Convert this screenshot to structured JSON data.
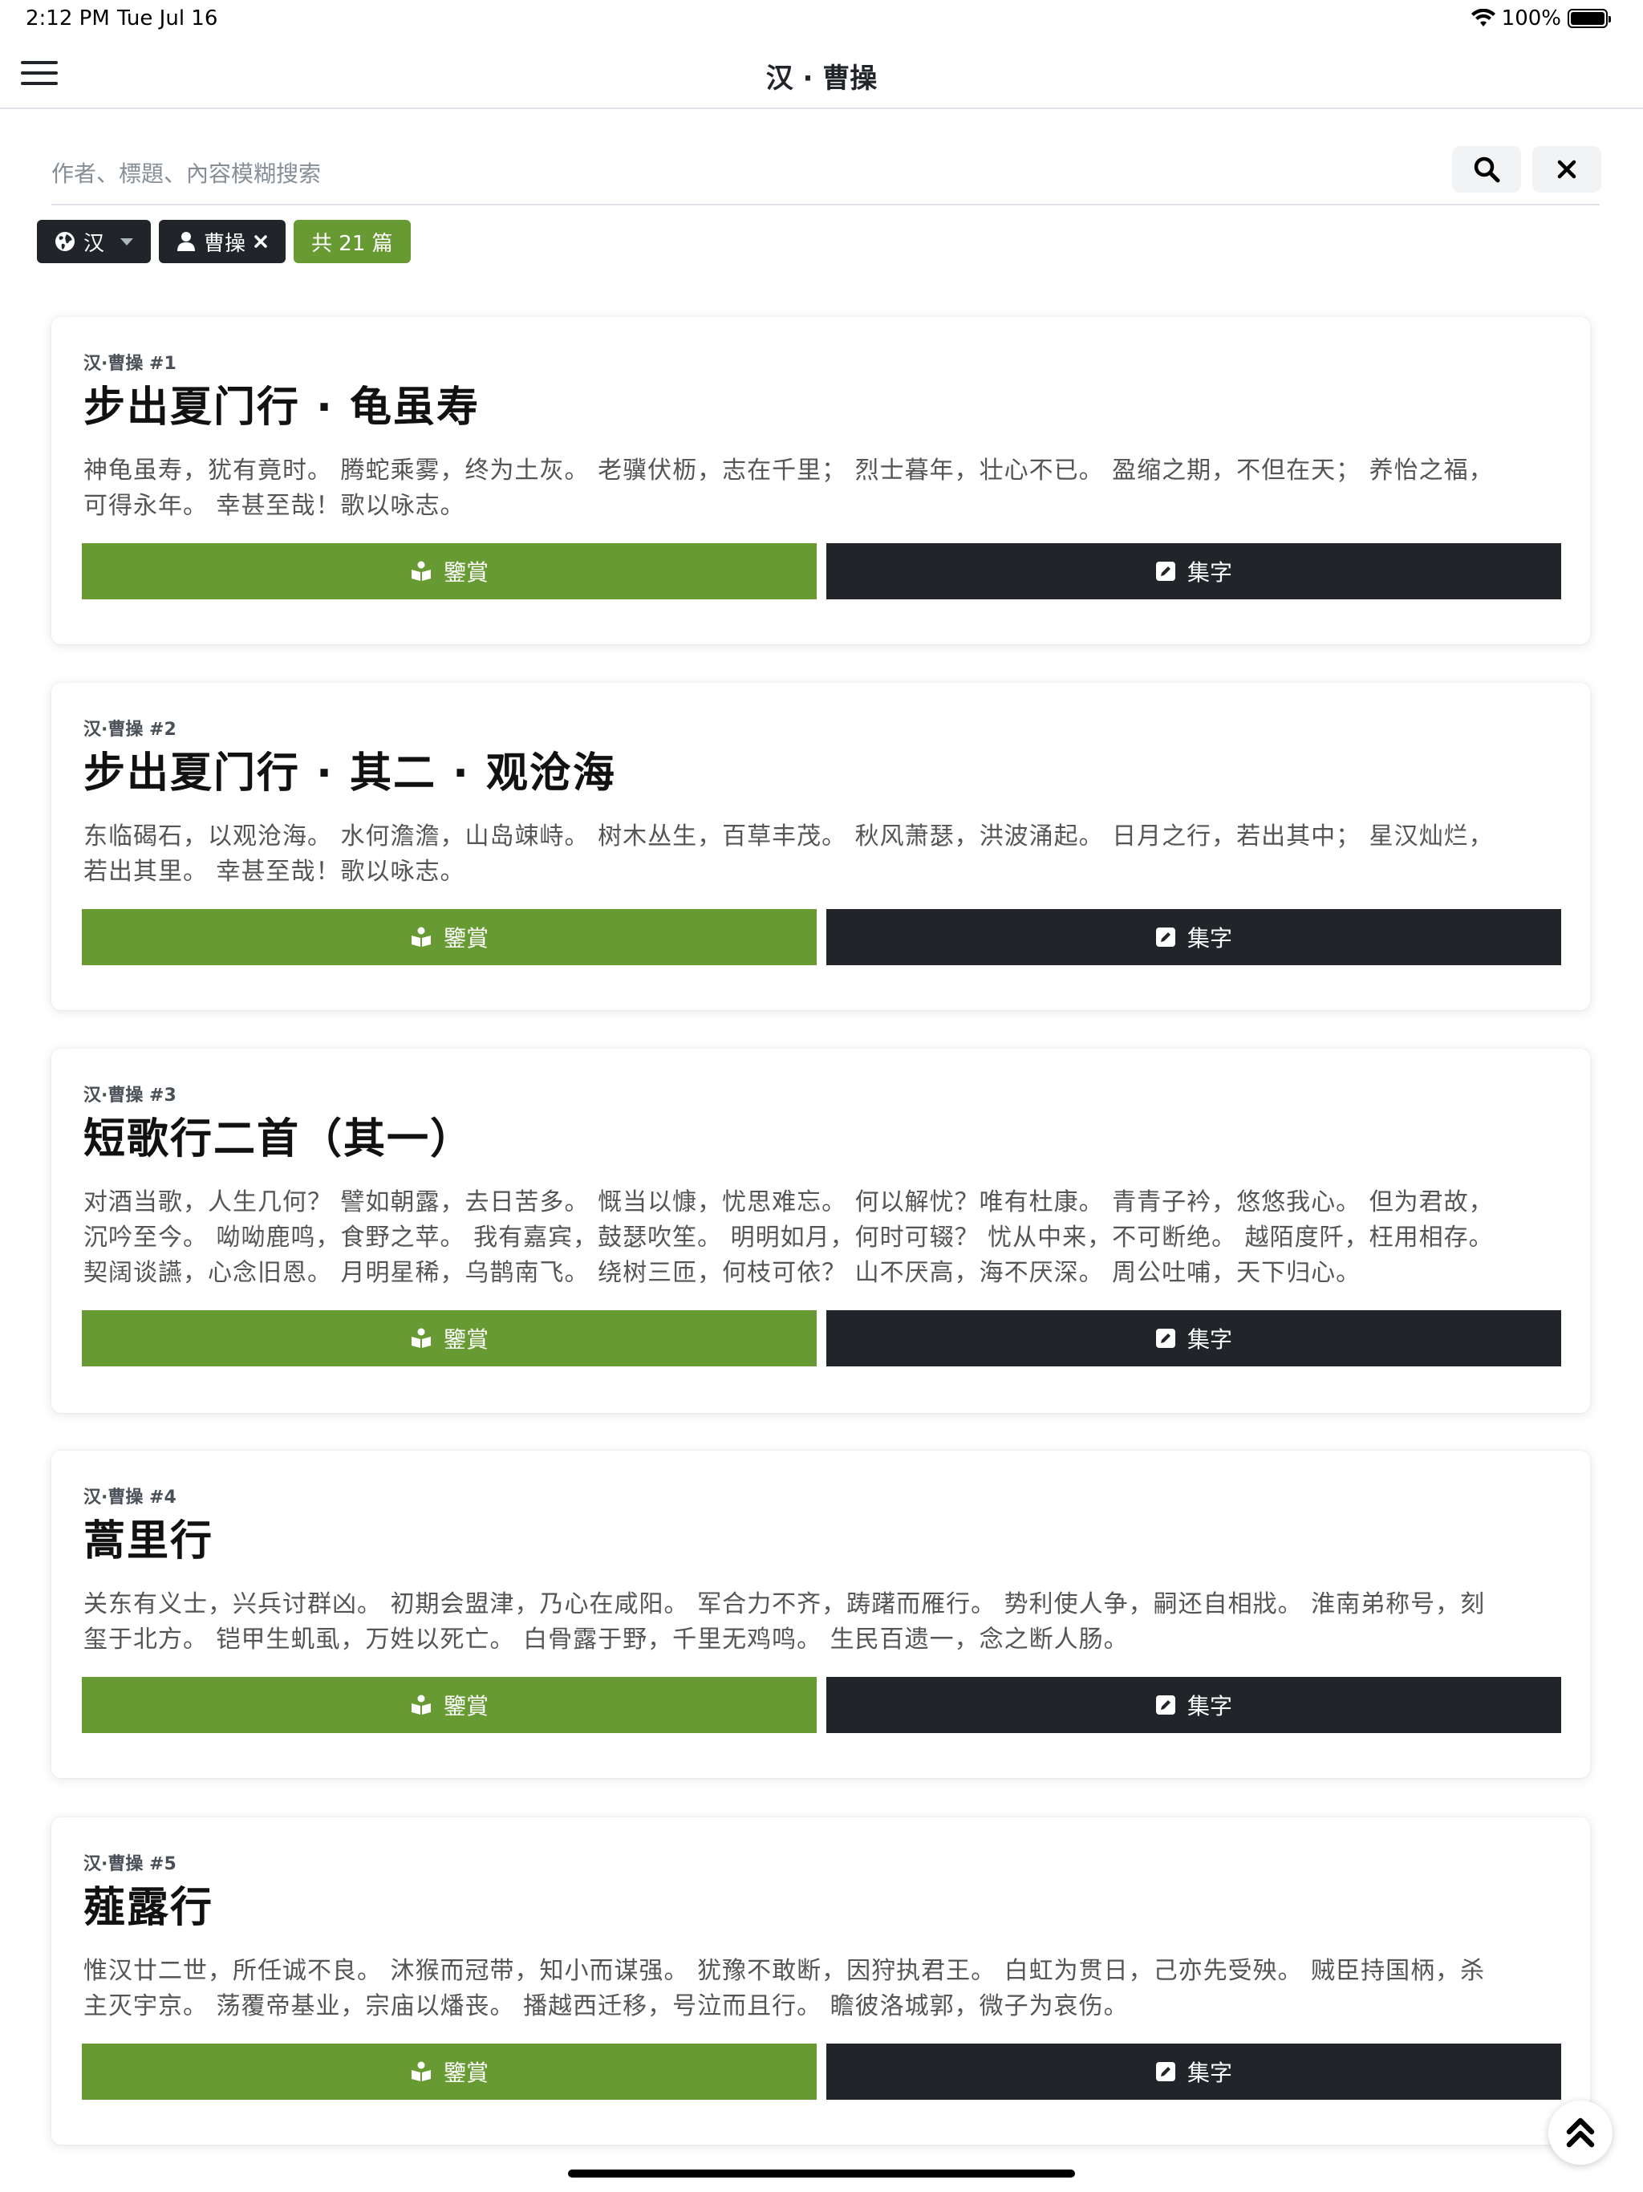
{
  "status": {
    "time": "2:12 PM",
    "date": "Tue Jul 16",
    "battery": "100%"
  },
  "navbar": {
    "title": "汉 · 曹操"
  },
  "search": {
    "placeholder": "作者、標題、內容模糊搜索"
  },
  "filters": {
    "dynasty": "汉",
    "author": "曹操",
    "count": "共 21 篇"
  },
  "buttons": {
    "appreciate": "鑒賞",
    "collect": "集字"
  },
  "poems": [
    {
      "meta": "汉·曹操 #1",
      "title": "步出夏门行 · 龟虽寿",
      "lines": [
        "神龟虽寿，犹有竟时。 腾蛇乘雾，终为土灰。 老骥伏枥，志在千里； 烈士暮年，壮心不已。 盈缩之期，不但在天； 养怡之福，",
        "可得永年。 幸甚至哉！歌以咏志。"
      ]
    },
    {
      "meta": "汉·曹操 #2",
      "title": "步出夏门行 · 其二 · 观沧海",
      "lines": [
        "东临碣石，以观沧海。 水何澹澹，山岛竦峙。 树木丛生，百草丰茂。 秋风萧瑟，洪波涌起。 日月之行，若出其中； 星汉灿烂，",
        "若出其里。 幸甚至哉！歌以咏志。"
      ]
    },
    {
      "meta": "汉·曹操 #3",
      "title": "短歌行二首（其一）",
      "lines": [
        "对酒当歌，人生几何？ 譬如朝露，去日苦多。 慨当以慷，忧思难忘。 何以解忧？唯有杜康。 青青子衿，悠悠我心。 但为君故，",
        "沉吟至今。 呦呦鹿鸣，食野之苹。 我有嘉宾，鼓瑟吹笙。 明明如月，何时可辍？ 忧从中来，不可断绝。 越陌度阡，枉用相存。",
        "契阔谈讌，心念旧恩。 月明星稀，乌鹊南飞。 绕树三匝，何枝可依？ 山不厌高，海不厌深。 周公吐哺，天下归心。"
      ]
    },
    {
      "meta": "汉·曹操 #4",
      "title": "蒿里行",
      "lines": [
        "关东有义士，兴兵讨群凶。 初期会盟津，乃心在咸阳。 军合力不齐，踌躇而雁行。 势利使人争，嗣还自相戕。 淮南弟称号，刻",
        "玺于北方。 铠甲生虮虱，万姓以死亡。 白骨露于野，千里无鸡鸣。 生民百遗一，念之断人肠。"
      ]
    },
    {
      "meta": "汉·曹操 #5",
      "title": "薤露行",
      "lines": [
        "惟汉廿二世，所任诚不良。 沐猴而冠带，知小而谋强。 犹豫不敢断，因狩执君王。 白虹为贯日，己亦先受殃。 贼臣持国柄，杀",
        "主灭宇京。 荡覆帝基业，宗庙以燔丧。 播越西迁移，号泣而且行。 瞻彼洛城郭，微子为哀伤。"
      ]
    }
  ]
}
